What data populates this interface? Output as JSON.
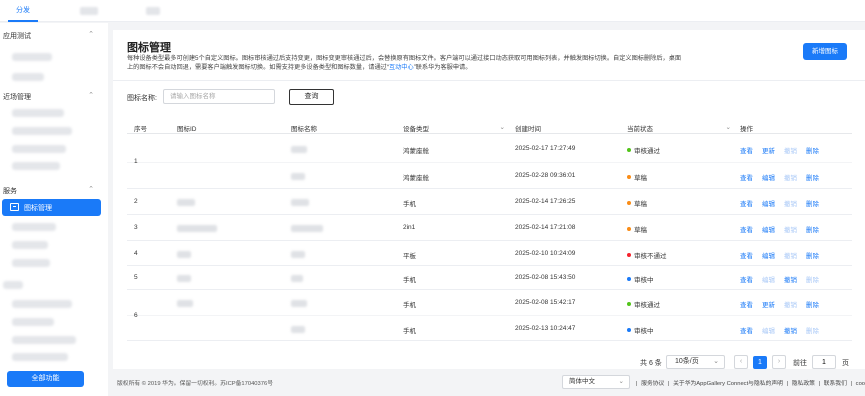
{
  "topbar": {
    "tabs": [
      {
        "label": "分发"
      }
    ]
  },
  "sidebar": {
    "groups": [
      {
        "label": "应用测试"
      },
      {
        "label": "近场管理"
      },
      {
        "label": "服务"
      }
    ],
    "active_item": "图标管理",
    "all_functions": "全部功能"
  },
  "main": {
    "title": "图标管理",
    "description_1": "每种设备类型最多可创建5个自定义图标。图标审核通过后支持变更，图标变更审核通过后，会替换原有图标文件。客户端可以通过接口动态获取可用图标列表，并触发图标切换。自定义图标删除后，桌面上的图标不会自动回退，需要客户端触发图标切换。如需支持更多设备类型和图标数量，请通过“",
    "description_link": "互动中心",
    "description_2": "”联系华为客服申请。",
    "new_button": "新增图标",
    "search": {
      "label": "图标名称:",
      "placeholder": "请输入图标名称",
      "query_button": "查询"
    },
    "table": {
      "headers": [
        "序号",
        "图标ID",
        "图标名称",
        "设备类型",
        "创建时间",
        "当前状态",
        "操作"
      ],
      "rows": [
        {
          "index": "1",
          "device": "鸿蒙座舱",
          "time": "2025-02-17 17:27:49",
          "status": "审核通过",
          "status_color": "#52c41a",
          "actions": [
            "查看",
            "更新",
            "撤销",
            "删除"
          ],
          "enabled": [
            true,
            true,
            false,
            true
          ]
        },
        {
          "index": "",
          "device": "鸿蒙座舱",
          "time": "2025-02-28 09:36:01",
          "status": "草稿",
          "status_color": "#fa8c16",
          "actions": [
            "查看",
            "编辑",
            "撤销",
            "删除"
          ],
          "enabled": [
            true,
            true,
            false,
            true
          ]
        },
        {
          "index": "2",
          "device": "手机",
          "time": "2025-02-14 17:26:25",
          "status": "草稿",
          "status_color": "#fa8c16",
          "actions": [
            "查看",
            "编辑",
            "撤销",
            "删除"
          ],
          "enabled": [
            true,
            true,
            false,
            true
          ]
        },
        {
          "index": "3",
          "device": "2in1",
          "time": "2025-02-14 17:21:08",
          "status": "草稿",
          "status_color": "#fa8c16",
          "actions": [
            "查看",
            "编辑",
            "撤销",
            "删除"
          ],
          "enabled": [
            true,
            true,
            false,
            true
          ]
        },
        {
          "index": "4",
          "device": "平板",
          "time": "2025-02-10 10:24:09",
          "status": "审核不通过",
          "status_color": "#f5222d",
          "actions": [
            "查看",
            "编辑",
            "撤销",
            "删除"
          ],
          "enabled": [
            true,
            true,
            false,
            true
          ]
        },
        {
          "index": "5",
          "device": "手机",
          "time": "2025-02-08 15:43:50",
          "status": "审核中",
          "status_color": "#1a7af8",
          "actions": [
            "查看",
            "编辑",
            "撤销",
            "删除"
          ],
          "enabled": [
            true,
            false,
            true,
            false
          ]
        },
        {
          "index": "6",
          "device": "手机",
          "time": "2025-02-08 15:42:17",
          "status": "审核通过",
          "status_color": "#52c41a",
          "actions": [
            "查看",
            "更新",
            "撤销",
            "删除"
          ],
          "enabled": [
            true,
            true,
            false,
            true
          ]
        },
        {
          "index": "",
          "device": "手机",
          "time": "2025-02-13 10:24:47",
          "status": "审核中",
          "status_color": "#1a7af8",
          "actions": [
            "查看",
            "编辑",
            "撤销",
            "删除"
          ],
          "enabled": [
            true,
            false,
            true,
            false
          ]
        }
      ]
    },
    "pagination": {
      "total": "共 6 条",
      "page_size": "10条/页",
      "current": "1",
      "goto_label": "前往",
      "goto_value": "1",
      "page_suffix": "页"
    }
  },
  "footer": {
    "copyright": "版权所有 © 2019 华为。保留一切权利。苏ICP备17040376号",
    "language": "简体中文",
    "links": [
      "服务协议",
      "关于华为AppGallery Connect与隐私的声明",
      "隐私政策",
      "联系我们",
      "cookies"
    ]
  }
}
